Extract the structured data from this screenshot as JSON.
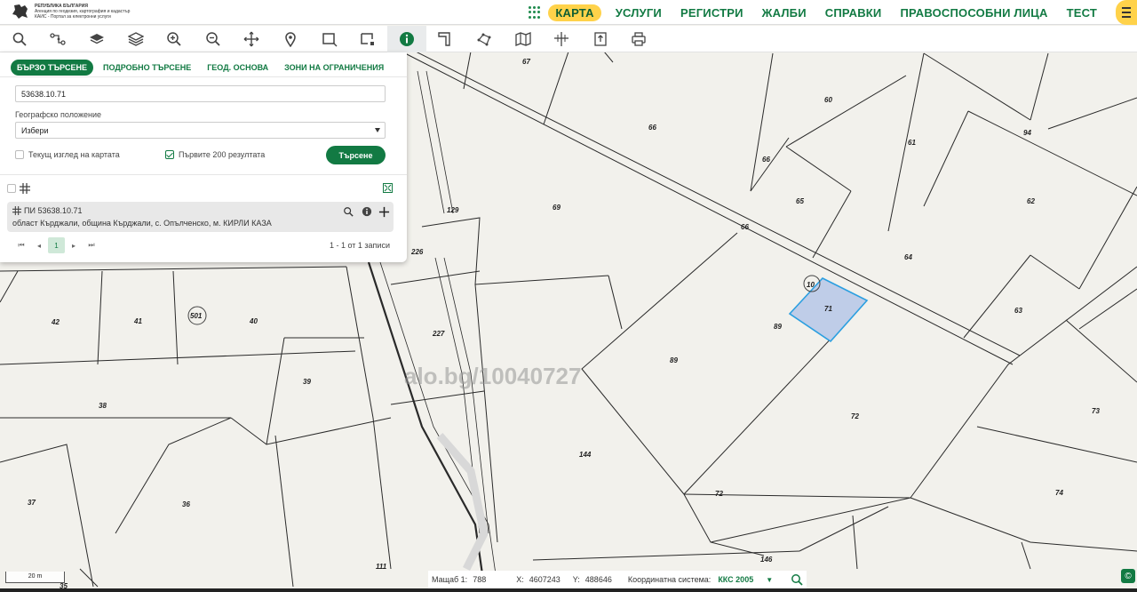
{
  "header": {
    "logo_line1": "РЕПУБЛИКА БЪЛГАРИЯ",
    "logo_line2": "Агенция по геодезия, картография и кадастър",
    "logo_line3": "КАИС - Портал за електронни услуги",
    "nav": [
      {
        "label": "КАРТА",
        "active": true
      },
      {
        "label": "УСЛУГИ"
      },
      {
        "label": "РЕГИСТРИ"
      },
      {
        "label": "ЖАЛБИ"
      },
      {
        "label": "СПРАВКИ"
      },
      {
        "label": "ПРАВОСПОСОБНИ ЛИЦА"
      },
      {
        "label": "ТЕСТ"
      }
    ]
  },
  "toolbar": {
    "tools": [
      "search-icon",
      "route-icon",
      "layers-icon",
      "layers-stack-icon",
      "zoom-in-icon",
      "zoom-out-icon",
      "pan-icon",
      "marker-icon",
      "select-rect-icon",
      "select-area-icon",
      "info-icon",
      "measure-icon",
      "polygon-icon",
      "map-icon",
      "coordinates-icon",
      "export-icon",
      "print-icon"
    ],
    "active_tool": "info-icon"
  },
  "search_panel": {
    "tabs": [
      "БЪРЗО ТЪРСЕНЕ",
      "ПОДРОБНО ТЪРСЕНЕ",
      "ГЕОД. ОСНОВА",
      "ЗОНИ НА ОГРАНИЧЕНИЯ"
    ],
    "query_value": "53638.10.71",
    "location_label": "Географско положение",
    "location_value": "Избери",
    "current_view_label": "Текущ изглед на картата",
    "current_view_checked": false,
    "first200_label": "Първите 200 резултата",
    "first200_checked": true,
    "search_button": "Търсене",
    "result": {
      "title": "ПИ 53638.10.71",
      "subtitle": "област Кърджали, община Кърджали, с. Опълченско, м. КИРЛИ КАЗА"
    },
    "pager": {
      "current_page": "1",
      "info": "1 - 1 от 1 записи"
    }
  },
  "map": {
    "watermark": "alo.bg/10040727",
    "selected_parcel": "71",
    "selected_fill": "#bfcde8",
    "selected_stroke": "#2b9fe0",
    "plot_labels": [
      "67",
      "60",
      "66",
      "94",
      "66",
      "61",
      "69",
      "129",
      "65",
      "62",
      "66",
      "226",
      "64",
      "10",
      "71",
      "63",
      "42",
      "41",
      "501",
      "40",
      "227",
      "89",
      "89",
      "39",
      "38",
      "72",
      "73",
      "144",
      "72",
      "74",
      "37",
      "36",
      "146",
      "111",
      "35"
    ]
  },
  "status": {
    "scale_label": "Мащаб 1:",
    "scale_value": "788",
    "x_label": "X:",
    "x_value": "4607243",
    "y_label": "Y:",
    "y_value": "488646",
    "crs_label": "Координатна система:",
    "crs_value": "ККС 2005",
    "scalebar": "20 m"
  }
}
